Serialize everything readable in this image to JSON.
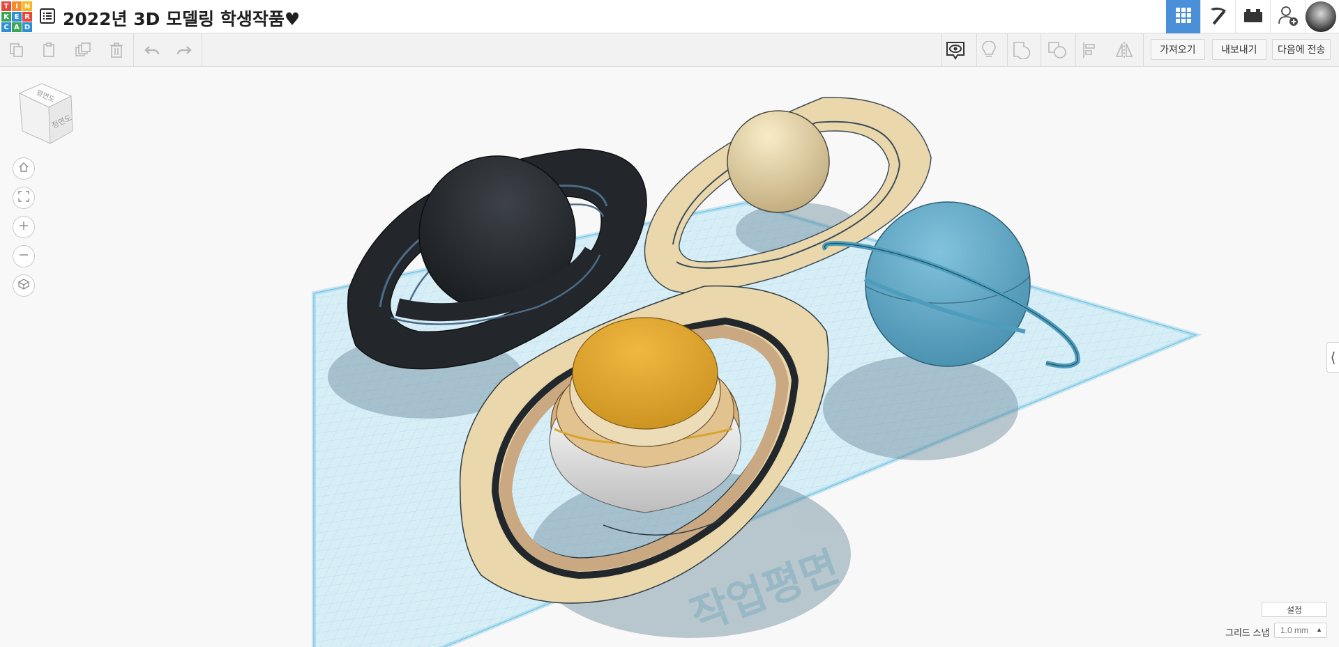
{
  "app": {
    "logo_letters": [
      "T",
      "I",
      "N",
      "K",
      "E",
      "R",
      "C",
      "A",
      "D"
    ],
    "logo_colors": [
      "#e8473c",
      "#f48b2d",
      "#f7b621",
      "#3aa757",
      "#2f8fd6",
      "#e8473c",
      "#2f8fd6",
      "#3aa757",
      "#2f8fd6"
    ],
    "title": "2022년 3D 모델링 학생작품♥",
    "accent_color": "#4a90d9"
  },
  "header_buttons": [
    {
      "name": "3d-design-view",
      "icon": "grid-icon",
      "active": true
    },
    {
      "name": "minecraft-view",
      "icon": "pickaxe-icon",
      "active": false
    },
    {
      "name": "bricks-view",
      "icon": "brick-icon",
      "active": false
    },
    {
      "name": "invite-user",
      "icon": "add-user-icon",
      "active": false
    }
  ],
  "toolbar": {
    "left_icons": [
      "copy-icon",
      "paste-icon",
      "duplicate-icon",
      "delete-icon",
      "undo-icon",
      "redo-icon"
    ],
    "right_icons": [
      "notes-visibility-icon",
      "light-bulb-icon",
      "group-icon",
      "ungroup-icon",
      "align-icon",
      "mirror-icon"
    ],
    "import_label": "가져오기",
    "export_label": "내보내기",
    "send_to_label": "다음에 전송"
  },
  "viewcube": {
    "top_label": "평면도",
    "front_label": "정면도"
  },
  "nav_controls": [
    "home-view-icon",
    "fit-all-icon",
    "zoom-in-icon",
    "zoom-out-icon",
    "perspective-icon"
  ],
  "workplane": {
    "settings_label": "설정",
    "grid_snap_label": "그리드 스냅",
    "grid_snap_value": "1.0 mm",
    "watermark": "작업평면"
  },
  "scene_objects": [
    {
      "name": "dark-ringed-planet",
      "color": "#262a2e"
    },
    {
      "name": "cream-ringed-planet",
      "color": "#e9d6ad"
    },
    {
      "name": "blue-ringed-planet",
      "color": "#6aaecb"
    },
    {
      "name": "yellow-white-planet",
      "color": "#dca531"
    }
  ]
}
